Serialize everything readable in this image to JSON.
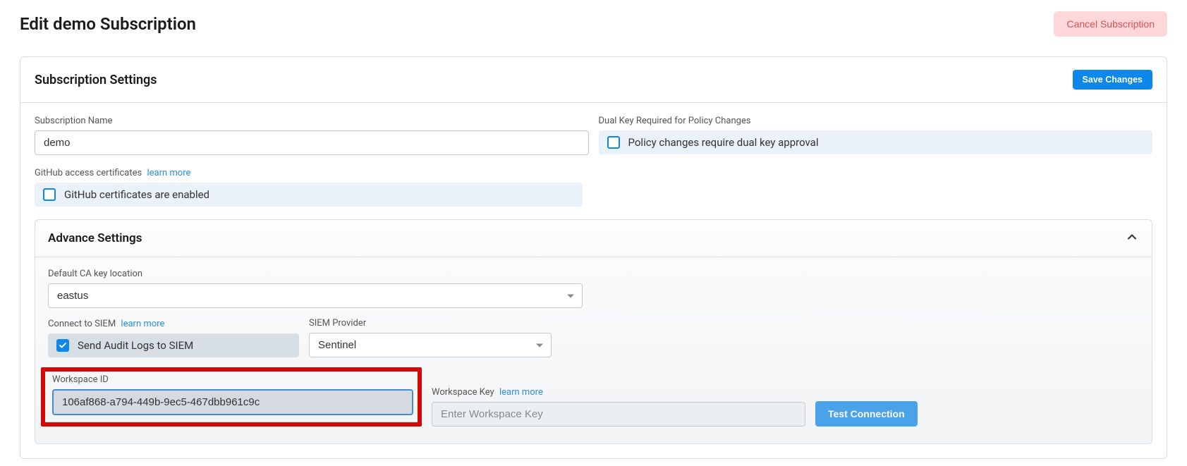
{
  "header": {
    "page_title": "Edit demo Subscription",
    "cancel_btn": "Cancel Subscription"
  },
  "settings_card": {
    "title": "Subscription Settings",
    "save_btn": "Save Changes",
    "subscription_name_label": "Subscription Name",
    "subscription_name_value": "demo",
    "dual_key_label": "Dual Key Required for Policy Changes",
    "dual_key_checkbox_text": "Policy changes require dual key approval",
    "github_label": "GitHub access certificates",
    "github_learn_more": "learn more",
    "github_checkbox_text": "GitHub certificates are enabled"
  },
  "advance": {
    "title": "Advance Settings",
    "ca_key_label": "Default CA key location",
    "ca_key_value": "eastus",
    "connect_siem_label": "Connect to SIEM",
    "connect_siem_learn_more": "learn more",
    "send_audit_text": "Send Audit Logs to SIEM",
    "siem_provider_label": "SIEM Provider",
    "siem_provider_value": "Sentinel",
    "workspace_id_label": "Workspace ID",
    "workspace_id_value": "106af868-a794-449b-9ec5-467dbb961c9c",
    "workspace_key_label": "Workspace Key",
    "workspace_key_learn_more": "learn more",
    "workspace_key_placeholder": "Enter Workspace Key",
    "test_connection_btn": "Test Connection"
  }
}
